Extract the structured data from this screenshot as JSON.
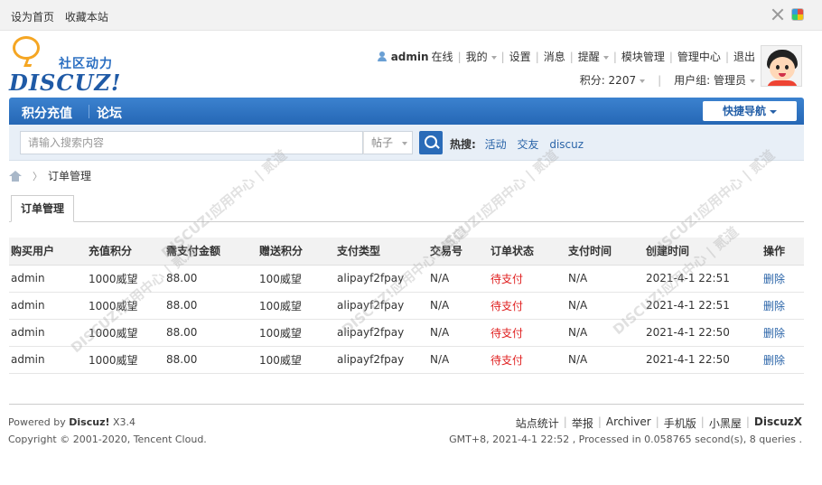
{
  "topbar": {
    "set_home": "设为首页",
    "bookmark": "收藏本站"
  },
  "logo": {
    "cn": "社区动力",
    "en": "DISCUZ!"
  },
  "user": {
    "name": "admin",
    "online": "在线",
    "menu": [
      "我的",
      "设置",
      "消息",
      "提醒",
      "模块管理",
      "管理中心",
      "退出"
    ],
    "points_label": "积分: 2207",
    "group_label": "用户组: 管理员"
  },
  "nav": {
    "items": [
      "积分充值",
      "论坛"
    ],
    "quick_nav": "快捷导航"
  },
  "search": {
    "placeholder": "请输入搜索内容",
    "type": "帖子",
    "hot_label": "热搜:",
    "hot_terms": [
      "活动",
      "交友",
      "discuz"
    ]
  },
  "breadcrumb": {
    "current": "订单管理"
  },
  "tab": {
    "label": "订单管理"
  },
  "table": {
    "headers": [
      "购买用户",
      "充值积分",
      "需支付金额",
      "赠送积分",
      "支付类型",
      "交易号",
      "订单状态",
      "支付时间",
      "创建时间",
      "操作"
    ],
    "rows": [
      [
        "admin",
        "1000威望",
        "88.00",
        "100威望",
        "alipayf2fpay",
        "N/A",
        "待支付",
        "N/A",
        "2021-4-1 22:51",
        "删除"
      ],
      [
        "admin",
        "1000威望",
        "88.00",
        "100威望",
        "alipayf2fpay",
        "N/A",
        "待支付",
        "N/A",
        "2021-4-1 22:51",
        "删除"
      ],
      [
        "admin",
        "1000威望",
        "88.00",
        "100威望",
        "alipayf2fpay",
        "N/A",
        "待支付",
        "N/A",
        "2021-4-1 22:50",
        "删除"
      ],
      [
        "admin",
        "1000威望",
        "88.00",
        "100威望",
        "alipayf2fpay",
        "N/A",
        "待支付",
        "N/A",
        "2021-4-1 22:50",
        "删除"
      ]
    ]
  },
  "footer": {
    "powered_prefix": "Powered by",
    "powered_brand": "Discuz!",
    "powered_version": "X3.4",
    "copyright": "Copyright © 2001-2020, Tencent Cloud.",
    "links": [
      "站点统计",
      "举报",
      "Archiver",
      "手机版",
      "小黑屋"
    ],
    "brand": "DiscuzX",
    "stats": "GMT+8, 2021-4-1 22:52 , Processed in 0.058765 second(s), 8 queries ."
  },
  "watermark": "DISCUZ!应用中心 | 贰道"
}
